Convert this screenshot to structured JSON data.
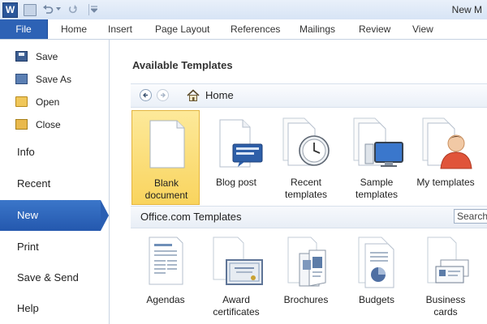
{
  "window": {
    "app_icon": "W",
    "title": "New M"
  },
  "ribbon": {
    "tabs": [
      {
        "label": "File"
      },
      {
        "label": "Home"
      },
      {
        "label": "Insert"
      },
      {
        "label": "Page Layout"
      },
      {
        "label": "References"
      },
      {
        "label": "Mailings"
      },
      {
        "label": "Review"
      },
      {
        "label": "View"
      }
    ]
  },
  "nav": {
    "commands": [
      {
        "label": "Save",
        "icon": "save-icon"
      },
      {
        "label": "Save As",
        "icon": "save-as-icon"
      },
      {
        "label": "Open",
        "icon": "open-folder-icon"
      },
      {
        "label": "Close",
        "icon": "close-folder-icon"
      }
    ],
    "items": [
      {
        "label": "Info"
      },
      {
        "label": "Recent"
      },
      {
        "label": "New",
        "active": true
      },
      {
        "label": "Print"
      },
      {
        "label": "Save & Send"
      },
      {
        "label": "Help"
      }
    ]
  },
  "main": {
    "title": "Available Templates",
    "breadcrumb": "Home",
    "templates": [
      {
        "line1": "Blank",
        "line2": "document",
        "icon": "blank-document-icon",
        "selected": true
      },
      {
        "line1": "Blog post",
        "line2": "",
        "icon": "blog-post-icon"
      },
      {
        "line1": "Recent",
        "line2": "templates",
        "icon": "clock-icon"
      },
      {
        "line1": "Sample",
        "line2": "templates",
        "icon": "monitor-icon"
      },
      {
        "line1": "My templates",
        "line2": "",
        "icon": "person-icon"
      }
    ],
    "office": {
      "title": "Office.com Templates",
      "search_placeholder": "Search",
      "categories": [
        {
          "line1": "Agendas",
          "line2": "",
          "icon": "agenda-icon"
        },
        {
          "line1": "Award",
          "line2": "certificates",
          "icon": "certificate-icon"
        },
        {
          "line1": "Brochures",
          "line2": "",
          "icon": "brochure-icon"
        },
        {
          "line1": "Budgets",
          "line2": "",
          "icon": "budget-chart-icon"
        },
        {
          "line1": "Business",
          "line2": "cards",
          "icon": "business-card-icon"
        }
      ]
    }
  },
  "colors": {
    "file_tab": "#2d62b5",
    "active_nav": "#2a5fb3",
    "selected_tile": "#f9d45e"
  }
}
